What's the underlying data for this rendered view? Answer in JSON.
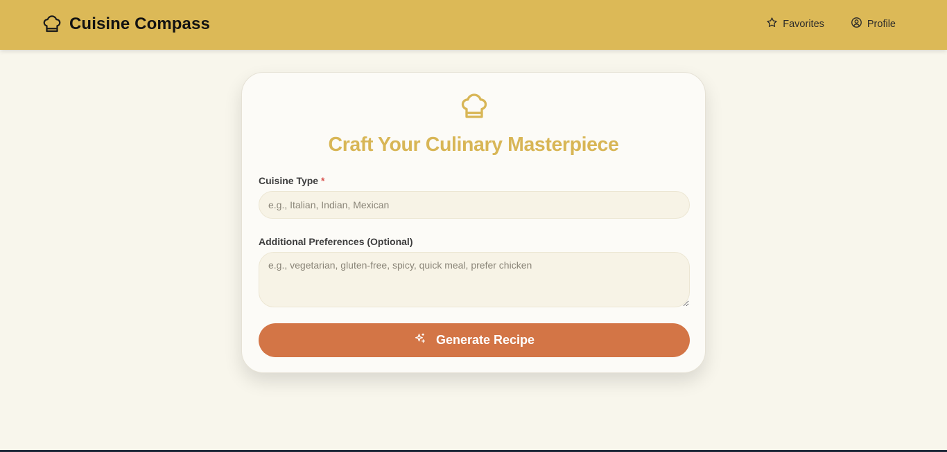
{
  "header": {
    "brand_title": "Cuisine Compass",
    "brand_icon": "chef-hat-icon",
    "nav": [
      {
        "label": "Favorites",
        "icon": "star-icon"
      },
      {
        "label": "Profile",
        "icon": "user-circle-icon"
      }
    ],
    "background_color": "#dcb957"
  },
  "card": {
    "icon": "chef-hat-icon",
    "title": "Craft Your Culinary Masterpiece",
    "title_color": "#d8b656",
    "cuisine": {
      "label": "Cuisine Type",
      "required_marker": "*",
      "value": "",
      "placeholder": "e.g., Italian, Indian, Mexican"
    },
    "preferences": {
      "label": "Additional Preferences (Optional)",
      "value": "",
      "placeholder": "e.g., vegetarian, gluten-free, spicy, quick meal, prefer chicken"
    },
    "submit": {
      "label": "Generate Recipe",
      "icon": "sparkles-icon",
      "color": "#d37546"
    }
  }
}
